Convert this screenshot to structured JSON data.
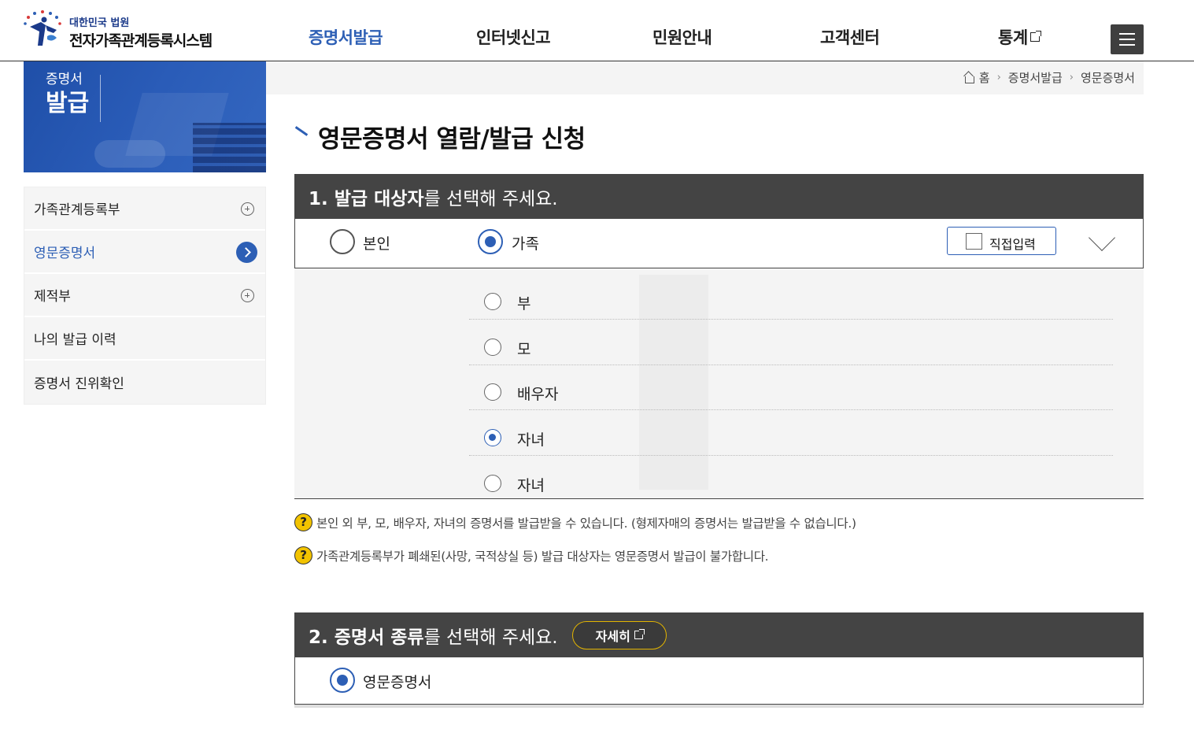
{
  "header": {
    "logo_small": "대한민국 법원",
    "logo_main": "전자가족관계등록시스템",
    "nav": [
      {
        "label": "증명서발급",
        "active": true
      },
      {
        "label": "인터넷신고",
        "active": false
      },
      {
        "label": "민원안내",
        "active": false
      },
      {
        "label": "고객센터",
        "active": false
      },
      {
        "label": "통계",
        "active": false,
        "external": true
      }
    ],
    "menu_icon": "hamburger-icon"
  },
  "sidebar": {
    "banner_small": "증명서",
    "banner_big": "발급",
    "items": [
      {
        "label": "가족관계등록부",
        "icon": "plus-circle-icon",
        "active": false
      },
      {
        "label": "영문증명서",
        "icon": "arrow-circle-icon",
        "active": true
      },
      {
        "label": "제적부",
        "icon": "plus-circle-icon",
        "active": false
      },
      {
        "label": "나의 발급 이력",
        "icon": "",
        "active": false
      },
      {
        "label": "증명서 진위확인",
        "icon": "",
        "active": false
      }
    ]
  },
  "breadcrumb": [
    "홈",
    "증명서발급",
    "영문증명서"
  ],
  "page_title": "영문증명서 열람/발급 신청",
  "section1": {
    "bold": "1. 발급 대상자",
    "rest": "를 선택해 주세요.",
    "options": [
      {
        "label": "본인",
        "checked": false
      },
      {
        "label": "가족",
        "checked": true
      }
    ],
    "direct_input_label": "직접입력",
    "family": [
      {
        "label": "부",
        "checked": false
      },
      {
        "label": "모",
        "checked": false
      },
      {
        "label": "배우자",
        "checked": false
      },
      {
        "label": "자녀",
        "checked": true
      },
      {
        "label": "자녀",
        "checked": false
      }
    ]
  },
  "notices": [
    "본인 외 부, 모, 배우자, 자녀의 증명서를 발급받을 수 있습니다. (형제자매의 증명서는 발급받을 수 없습니다.)",
    "가족관계등록부가 폐쇄된(사망, 국적상실 등) 발급 대상자는 영문증명서 발급이 불가합니다."
  ],
  "help_symbol": "?",
  "section2": {
    "bold": "2. 증명서 종류",
    "rest": "를 선택해 주세요.",
    "detail_label": "자세히",
    "options": [
      {
        "label": "영문증명서",
        "checked": true
      }
    ]
  },
  "colors": {
    "accent": "#2d5fb5",
    "header_bar": "#444444",
    "help_yellow": "#f2c300"
  }
}
